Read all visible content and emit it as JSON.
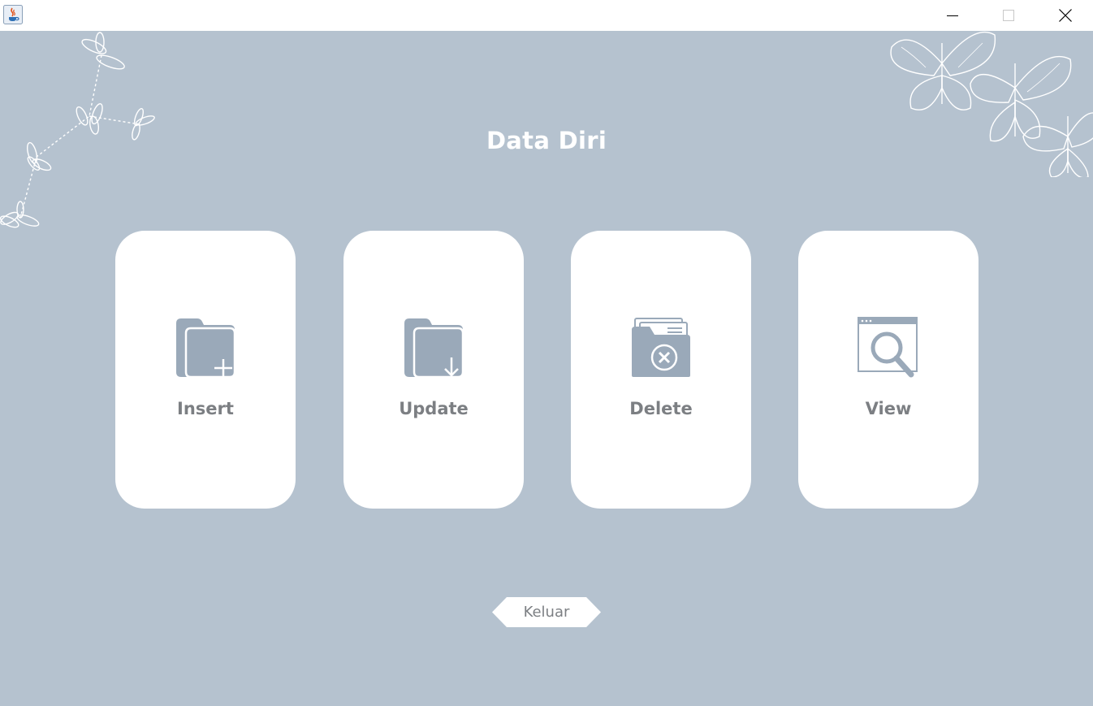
{
  "window": {
    "app_icon": "java-coffee-icon",
    "controls": [
      "minimize-icon",
      "maximize-icon",
      "close-icon"
    ]
  },
  "page": {
    "title": "Data Diri"
  },
  "menu": {
    "insert": {
      "label": "Insert",
      "icon": "folder-plus-icon"
    },
    "update": {
      "label": "Update",
      "icon": "folder-download-icon"
    },
    "delete": {
      "label": "Delete",
      "icon": "folder-delete-icon"
    },
    "view": {
      "label": "View",
      "icon": "window-search-icon"
    }
  },
  "exit": {
    "label": "Keluar"
  },
  "colors": {
    "background": "#b5c2cf",
    "card": "#ffffff",
    "icon": "#9aa9b9",
    "label": "#7c7f83"
  }
}
